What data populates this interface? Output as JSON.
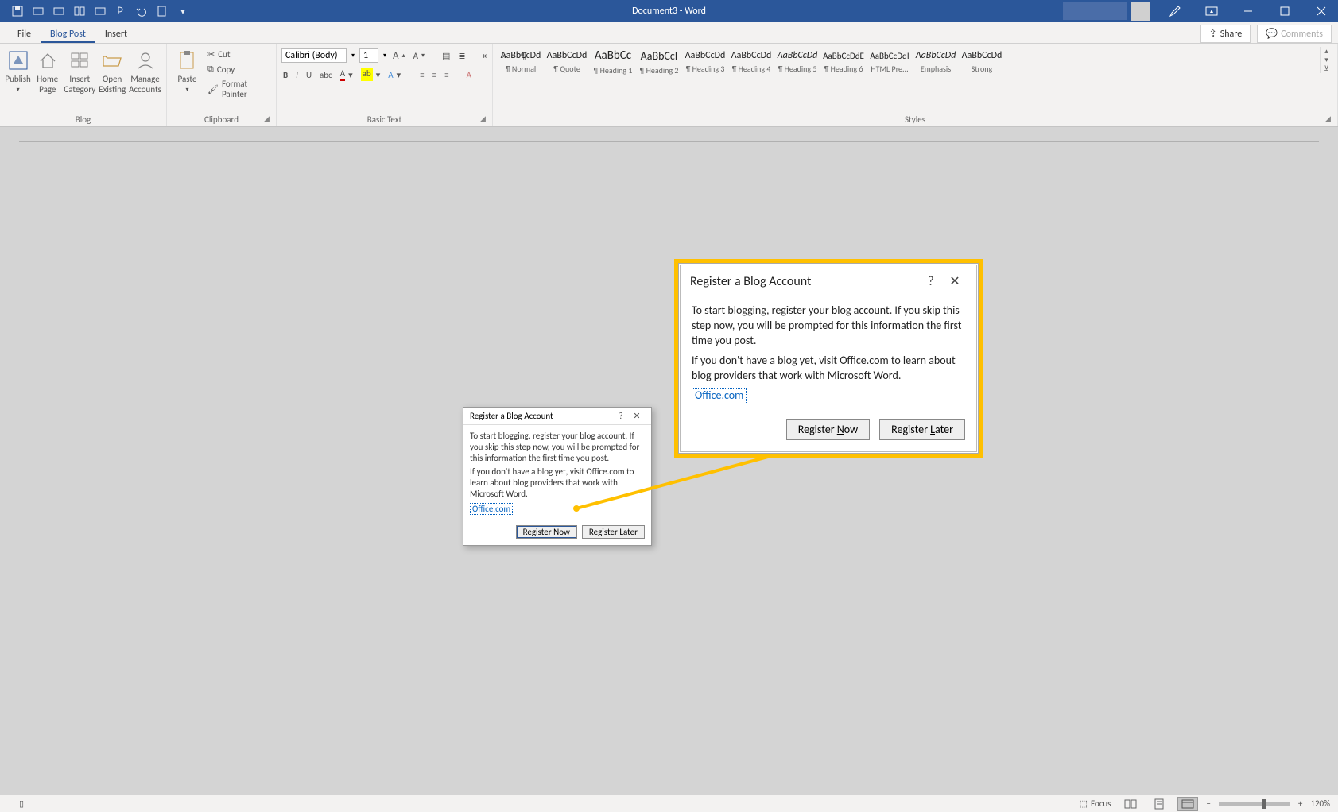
{
  "title": "Document3 - Word",
  "tabs": {
    "file": "File",
    "blogpost": "Blog Post",
    "insert": "Insert"
  },
  "tabs_right": {
    "share": "Share",
    "comments": "Comments"
  },
  "ribbon": {
    "blog": {
      "label": "Blog",
      "publish": "Publish",
      "home": "Home\nPage",
      "insert_category": "Insert\nCategory",
      "open_existing": "Open\nExisting",
      "manage_accounts": "Manage\nAccounts"
    },
    "clipboard": {
      "label": "Clipboard",
      "paste": "Paste",
      "cut": "Cut",
      "copy": "Copy",
      "format_painter": "Format Painter"
    },
    "basic_text": {
      "label": "Basic Text",
      "font_name": "Calibri (Body)",
      "font_size": "1"
    },
    "styles": {
      "label": "Styles",
      "items": [
        {
          "preview": "AaBbCcDd",
          "name": "¶ Normal",
          "size": "12"
        },
        {
          "preview": "AaBbCcDd",
          "name": "¶ Quote",
          "size": "12"
        },
        {
          "preview": "AaBbCc",
          "name": "¶ Heading 1",
          "size": "15"
        },
        {
          "preview": "AaBbCcI",
          "name": "¶ Heading 2",
          "size": "14"
        },
        {
          "preview": "AaBbCcDd",
          "name": "¶ Heading 3",
          "size": "12"
        },
        {
          "preview": "AaBbCcDd",
          "name": "¶ Heading 4",
          "size": "12"
        },
        {
          "preview": "AaBbCcDd",
          "name": "¶ Heading 5",
          "size": "12",
          "italic": true
        },
        {
          "preview": "AaBbCcDdE",
          "name": "¶ Heading 6",
          "size": "11"
        },
        {
          "preview": "AaBbCcDdI",
          "name": "HTML Pre...",
          "size": "11"
        },
        {
          "preview": "AaBbCcDd",
          "name": "Emphasis",
          "size": "12",
          "italic": true
        },
        {
          "preview": "AaBbCcDd",
          "name": "Strong",
          "size": "12"
        }
      ]
    }
  },
  "dialog": {
    "title": "Register a Blog Account",
    "p1": "To start blogging, register your blog account. If you skip this step now, you will be prompted for this information the first time you post.",
    "p2": "If you don't have a blog yet, visit Office.com to learn about blog providers that work with Microsoft Word.",
    "link": "Office.com",
    "register_now": "Register Now",
    "register_later": "Register Later"
  },
  "status": {
    "focus": "Focus",
    "zoom": "120%"
  }
}
